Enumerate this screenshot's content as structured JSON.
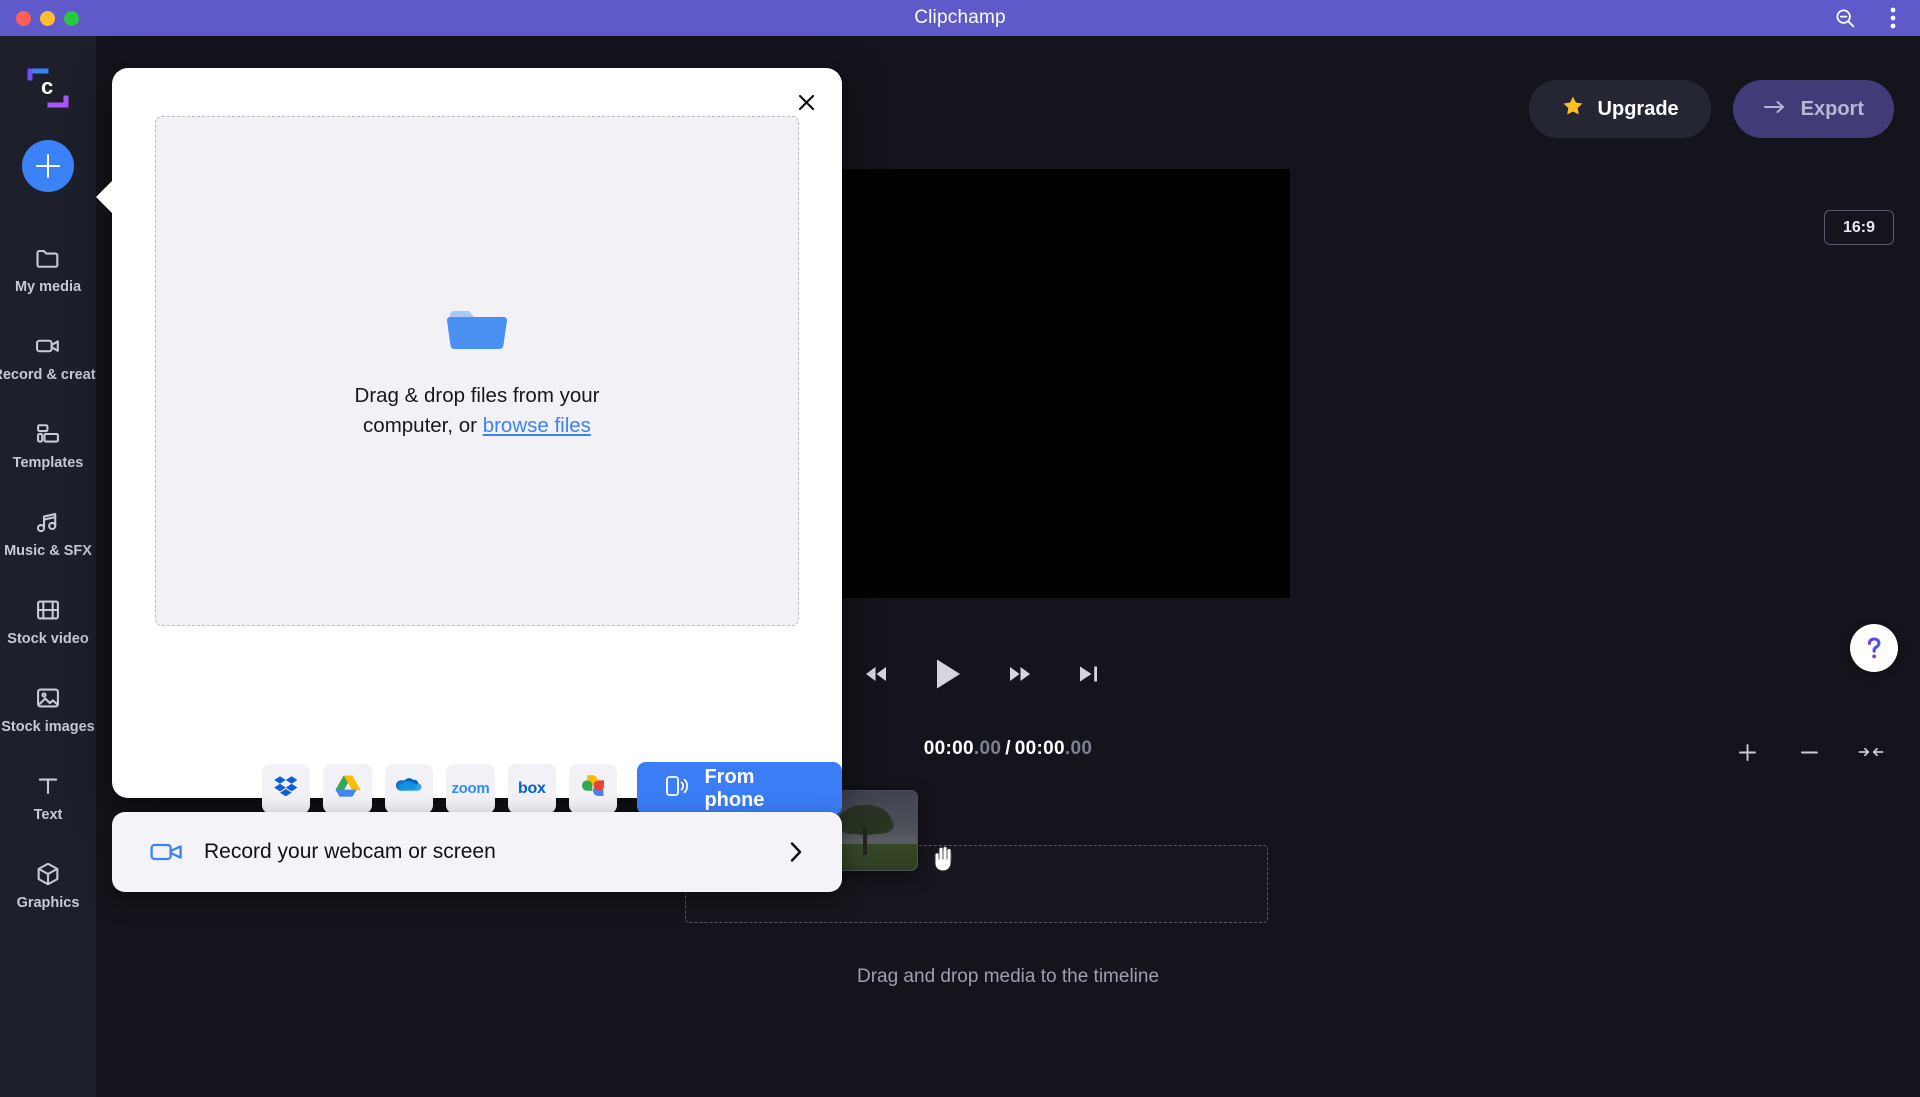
{
  "window": {
    "title": "Clipchamp",
    "traffic_lights": [
      "close",
      "minimize",
      "maximize"
    ],
    "search_icon": "search-zoom-out-icon",
    "menu_icon": "more-vertical-icon"
  },
  "sidebar": {
    "logo": "clipchamp-logo",
    "add_button": "plus-button",
    "items": [
      {
        "label": "My media",
        "icon": "folder-icon"
      },
      {
        "label": "Record & create",
        "icon": "video-camera-icon"
      },
      {
        "label": "Templates",
        "icon": "templates-icon"
      },
      {
        "label": "Music & SFX",
        "icon": "music-note-icon"
      },
      {
        "label": "Stock video",
        "icon": "film-strip-icon"
      },
      {
        "label": "Stock images",
        "icon": "image-icon"
      },
      {
        "label": "Text",
        "icon": "text-t-icon"
      },
      {
        "label": "Graphics",
        "icon": "cube-icon"
      }
    ]
  },
  "header": {
    "upgrade_label": "Upgrade",
    "upgrade_icon": "star-icon",
    "export_label": "Export",
    "export_icon": "arrow-right-icon"
  },
  "preview": {
    "aspect_ratio": "16:9",
    "help_icon": "question-mark-icon"
  },
  "transport": {
    "skip_start": "skip-to-start-icon",
    "rewind": "rewind-icon",
    "play": "play-icon",
    "fast_forward": "fast-forward-icon",
    "skip_end": "skip-to-end-icon"
  },
  "timecode": {
    "current_main": "00:00",
    "current_frac": ".00",
    "separator": "/",
    "total_main": "00:00",
    "total_frac": ".00"
  },
  "zoom_tools": [
    {
      "name": "zoom-in-button",
      "icon": "plus-icon"
    },
    {
      "name": "zoom-out-button",
      "icon": "minus-icon"
    },
    {
      "name": "fit-to-screen-button",
      "icon": "fit-arrows-icon"
    }
  ],
  "timeline": {
    "hint": "Drag and drop media to the timeline",
    "dragged_item": "video-thumbnail-tree",
    "cursor": "grabbing-hand-cursor"
  },
  "modal": {
    "close_icon": "close-icon",
    "dropzone": {
      "icon": "folder-icon",
      "text_line1": "Drag & drop files from your",
      "text_line2_prefix": "computer, or ",
      "link": "browse files"
    },
    "services": [
      {
        "name": "dropbox",
        "label": "Dropbox"
      },
      {
        "name": "google-drive",
        "label": "Google Drive"
      },
      {
        "name": "onedrive",
        "label": "OneDrive"
      },
      {
        "name": "zoom",
        "label": "zoom"
      },
      {
        "name": "box",
        "label": "box"
      },
      {
        "name": "google-photos",
        "label": "Google Photos"
      }
    ],
    "from_phone": {
      "label": "From phone",
      "icon": "phone-signal-icon"
    }
  },
  "record_card": {
    "label": "Record your webcam or screen",
    "icon": "video-camera-icon",
    "chevron": "chevron-right-icon"
  },
  "colors": {
    "titlebar": "#6059c9",
    "app_bg": "#14151c",
    "rail_bg": "#1d1f2b",
    "accent_blue": "#3b82f6",
    "export_bg": "#413c78",
    "upgrade_bg": "#242633",
    "star_yellow": "#fbbf24"
  }
}
